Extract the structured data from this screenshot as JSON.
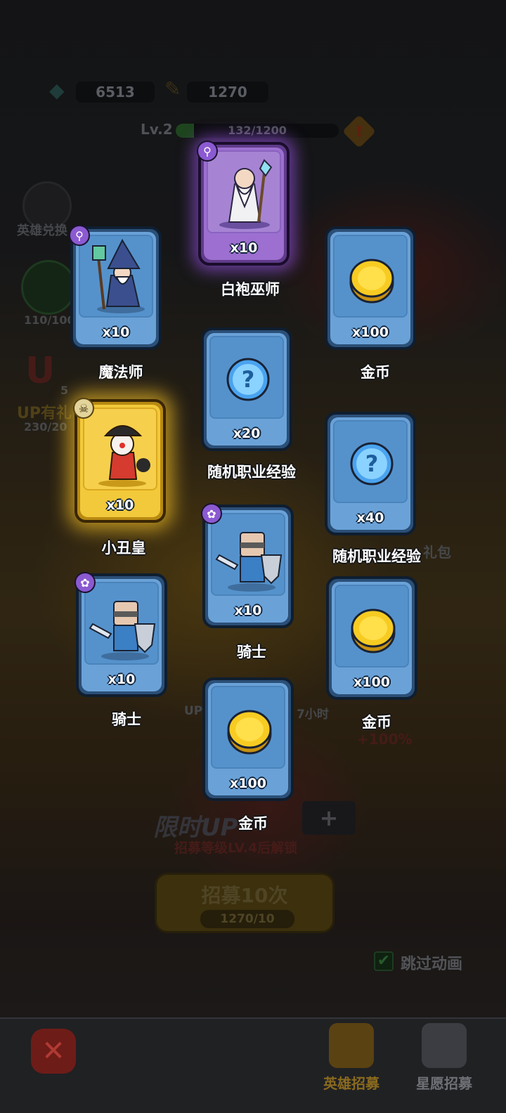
{
  "currency": {
    "gems": "6513",
    "tickets": "1270",
    "gem_icon": "gem-icon",
    "ticket_icon": "ticket-icon"
  },
  "level": {
    "label": "Lv.2",
    "xp_text": "132/1200",
    "xp_fraction": 0.11
  },
  "side": {
    "hero_exchange": "英雄兑换",
    "progress_text": "110/100",
    "up_count": "5",
    "up_label": "UP有礼",
    "up_progress": "230/20",
    "gift_label": "礼包",
    "up_bar_left": "UP",
    "up_bar_right": "7小时",
    "bonus": "+100%"
  },
  "banner": {
    "title": "限时UP",
    "unlock_text": "招募等级LV.4后解锁"
  },
  "recruit": {
    "label": "招募10次",
    "cost": "1270/10"
  },
  "skip": {
    "label": "跳过动画",
    "checked": true
  },
  "nav": {
    "hero_recruit": "英雄招募",
    "star_recruit": "星愿招募"
  },
  "rewards": [
    {
      "name": "白袍巫师",
      "qty": "x10",
      "rarity": "purple",
      "badge_icon": "staff-icon",
      "art": "white-wizard"
    },
    {
      "name": "魔法师",
      "qty": "x10",
      "rarity": "blue",
      "badge_icon": "staff-icon",
      "art": "mage"
    },
    {
      "name": "金币",
      "qty": "x100",
      "rarity": "blue",
      "badge_icon": "",
      "art": "coin"
    },
    {
      "name": "随机职业经验",
      "qty": "x20",
      "rarity": "blue",
      "badge_icon": "",
      "art": "mystery-orb"
    },
    {
      "name": "小丑皇",
      "qty": "x10",
      "rarity": "gold",
      "badge_icon": "skull-icon",
      "art": "clown-king"
    },
    {
      "name": "随机职业经验",
      "qty": "x40",
      "rarity": "blue",
      "badge_icon": "",
      "art": "mystery-orb"
    },
    {
      "name": "骑士",
      "qty": "x10",
      "rarity": "blue",
      "badge_icon": "paw-icon",
      "art": "knight"
    },
    {
      "name": "骑士",
      "qty": "x10",
      "rarity": "blue",
      "badge_icon": "paw-icon",
      "art": "knight"
    },
    {
      "name": "金币",
      "qty": "x100",
      "rarity": "blue",
      "badge_icon": "",
      "art": "coin"
    },
    {
      "name": "金币",
      "qty": "x100",
      "rarity": "blue",
      "badge_icon": "",
      "art": "coin"
    }
  ]
}
